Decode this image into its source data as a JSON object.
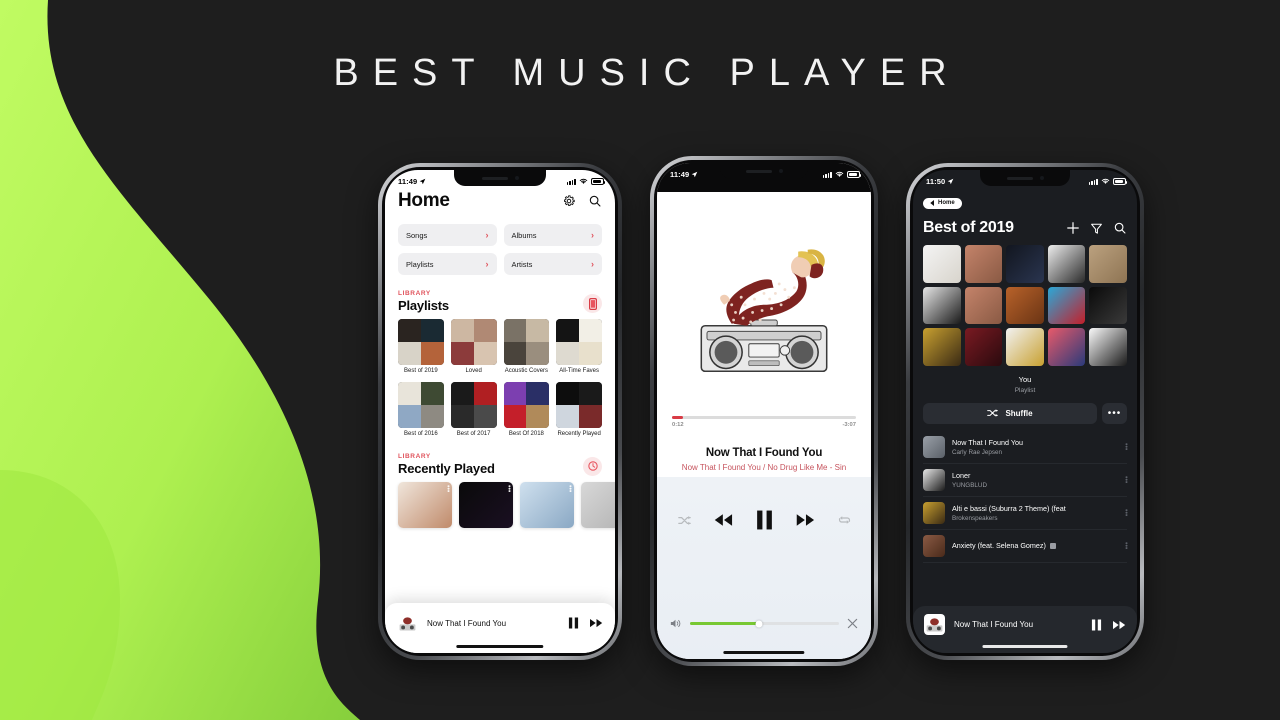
{
  "headline": "BEST MUSIC PLAYER",
  "colors": {
    "background": "#1e1e1e",
    "accent_green": "#b4f556",
    "accent_red": "#e0545d",
    "dark_panel": "#1b1d21"
  },
  "phone1": {
    "status": {
      "time": "11:49",
      "location_icon": "location-arrow-icon"
    },
    "title": "Home",
    "header_icons": [
      "gear-icon",
      "search-icon"
    ],
    "categories": [
      {
        "label": "Songs"
      },
      {
        "label": "Albums"
      },
      {
        "label": "Playlists"
      },
      {
        "label": "Artists"
      }
    ],
    "playlists_section": {
      "eyebrow": "LIBRARY",
      "title": "Playlists"
    },
    "playlists": [
      {
        "label": "Best of 2019",
        "colors": [
          "#2a2420",
          "#1a2a33",
          "#d8d3c8",
          "#b4633a"
        ]
      },
      {
        "label": "Loved",
        "colors": [
          "#cdb7a2",
          "#b08974",
          "#8c3b3b",
          "#d8c4b0"
        ]
      },
      {
        "label": "Acoustic Covers",
        "colors": [
          "#7a7266",
          "#c7b9a4",
          "#4a443c",
          "#9a8e7e"
        ]
      },
      {
        "label": "All-Time Faves",
        "colors": [
          "#141414",
          "#f2efe6",
          "#dedad0",
          "#e8e0cc"
        ]
      },
      {
        "label": "Best of 2016",
        "colors": [
          "#e8e4da",
          "#3e4a33",
          "#8fa8c4",
          "#8e8a82"
        ]
      },
      {
        "label": "Best of 2017",
        "colors": [
          "#1a1a1a",
          "#b01f22",
          "#2a2a2a",
          "#4a4a4a"
        ]
      },
      {
        "label": "Best Of 2018",
        "colors": [
          "#7c3fb0",
          "#2a2f66",
          "#c41f2a",
          "#b08a5a"
        ]
      },
      {
        "label": "Recently Played",
        "colors": [
          "#0d0d0d",
          "#1a1a1a",
          "#cfd6de",
          "#7a2a2a"
        ]
      }
    ],
    "recent_section": {
      "eyebrow": "LIBRARY",
      "title": "Recently Played"
    },
    "recently_played": [
      {
        "colors": [
          "#f0e6dc",
          "#c08a6a"
        ]
      },
      {
        "colors": [
          "#0a0a0a",
          "#1a0f22"
        ]
      },
      {
        "colors": [
          "#cfe0ee",
          "#8aa8c4"
        ]
      },
      {
        "colors": [
          "#d8d8d8",
          "#b0b0b0"
        ]
      }
    ],
    "mini_player": {
      "title": "Now That I Found You",
      "pause_icon": "pause-icon",
      "next_icon": "next-track-icon"
    }
  },
  "phone2": {
    "status": {
      "time": "11:49",
      "location_icon": "location-arrow-icon"
    },
    "artwork_alt": "Woman in red polka-dot jumpsuit reclining on a boombox",
    "progress": {
      "elapsed": "0:12",
      "remaining": "-3:07",
      "percent": 6
    },
    "song_title": "Now That I Found You",
    "album_line": "Now That I Found You / No Drug Like Me - Sin",
    "controls": [
      {
        "name": "shuffle-icon",
        "state": "dim"
      },
      {
        "name": "previous-track-icon",
        "state": "active"
      },
      {
        "name": "pause-icon",
        "state": "active"
      },
      {
        "name": "next-track-icon",
        "state": "active"
      },
      {
        "name": "repeat-icon",
        "state": "dim"
      }
    ],
    "volume": {
      "percent": 46,
      "icon": "speaker-icon",
      "close_icon": "close-icon"
    }
  },
  "phone3": {
    "status": {
      "time": "11:50",
      "location_icon": "location-arrow-icon"
    },
    "back_label": "Home",
    "title": "Best of 2019",
    "header_icons": [
      "plus-icon",
      "filter-icon",
      "search-icon"
    ],
    "grid": [
      {
        "colors": [
          "#f4f4f4",
          "#d8d4cc"
        ]
      },
      {
        "colors": [
          "#c4836a",
          "#8a5a44"
        ]
      },
      {
        "colors": [
          "#12161f",
          "#2a3550"
        ]
      },
      {
        "colors": [
          "#ededed",
          "#2a2a2a"
        ]
      },
      {
        "colors": [
          "#bba17f",
          "#8e7453"
        ]
      },
      {
        "colors": [
          "#e6e6e6",
          "#1a1a1a"
        ]
      },
      {
        "colors": [
          "#c4836a",
          "#8a5a44"
        ]
      },
      {
        "colors": [
          "#b8622a",
          "#6a3414"
        ]
      },
      {
        "colors": [
          "#2aa8d8",
          "#c41f2a"
        ]
      },
      {
        "colors": [
          "#0a0a0a",
          "#3a3a3a"
        ]
      },
      {
        "colors": [
          "#c8a030",
          "#3a2a14"
        ]
      },
      {
        "colors": [
          "#7a1a22",
          "#2a0a0e"
        ]
      },
      {
        "colors": [
          "#f2f2f2",
          "#c8a030"
        ]
      },
      {
        "colors": [
          "#e85a6a",
          "#2a3a7a"
        ]
      },
      {
        "colors": [
          "#fafafa",
          "#1a1a1a"
        ]
      }
    ],
    "owner": {
      "name": "You",
      "type": "Playlist"
    },
    "shuffle_label": "Shuffle",
    "more_label": "•••",
    "tracks": [
      {
        "name": "Now That I Found You",
        "artist": "Carly Rae Jepsen",
        "explicit": false,
        "colors": [
          "#9aa0a8",
          "#5a6068"
        ]
      },
      {
        "name": "Loner",
        "artist": "YUNGBLUD",
        "explicit": false,
        "colors": [
          "#e8e8e8",
          "#1a1a1a"
        ]
      },
      {
        "name": "Alti e bassi (Suburra 2 Theme) (feat",
        "artist": "Brokenspeakers",
        "explicit": false,
        "colors": [
          "#c8a030",
          "#3a2a14"
        ]
      },
      {
        "name": "Anxiety (feat. Selena Gomez)",
        "artist": "",
        "explicit": true,
        "colors": [
          "#8a5a44",
          "#4a2a1a"
        ]
      }
    ],
    "mini_player": {
      "title": "Now That I Found You",
      "pause_icon": "pause-icon",
      "next_icon": "next-track-icon"
    }
  }
}
